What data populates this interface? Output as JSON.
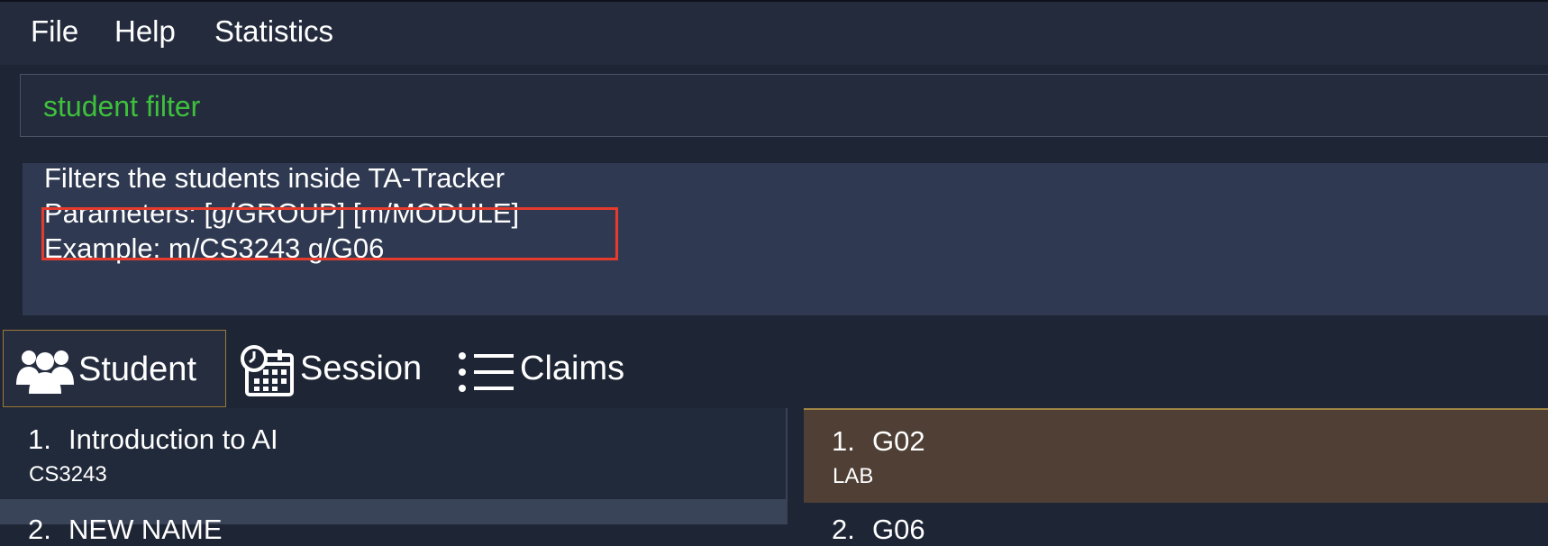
{
  "menu": {
    "file": "File",
    "help": "Help",
    "statistics": "Statistics"
  },
  "command_box": {
    "value": "student filter",
    "color": "#3fc03c"
  },
  "result_display": {
    "line1": "Filters the students inside TA-Tracker",
    "line2": "Parameters: [g/GROUP] [m/MODULE]",
    "line3": "Example: m/CS3243 g/G06",
    "highlight_color": "#e53b2d"
  },
  "tabs": [
    {
      "label": "Student",
      "icon": "students-icon",
      "selected": true
    },
    {
      "label": "Session",
      "icon": "calendar-clock-icon",
      "selected": false
    },
    {
      "label": "Claims",
      "icon": "list-icon",
      "selected": false
    }
  ],
  "modules": [
    {
      "index": "1.",
      "name": "Introduction to AI",
      "code": "CS3243"
    },
    {
      "index": "2.",
      "name": "NEW NAME",
      "code": ""
    }
  ],
  "groups": [
    {
      "index": "1.",
      "name": "G02",
      "type": "LAB"
    },
    {
      "index": "2.",
      "name": "G06",
      "type": ""
    }
  ]
}
